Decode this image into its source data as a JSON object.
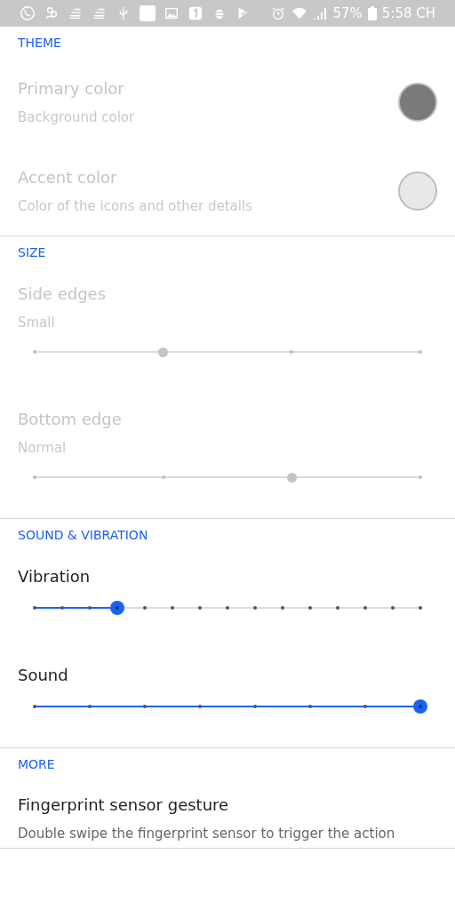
{
  "status_bar": {
    "battery": "57%",
    "time": "5:58 CH"
  },
  "sections": [
    {
      "title": "THEME",
      "items": [
        {
          "kind": "color",
          "title": "Primary color",
          "subtitle": "Background color",
          "disabled": true,
          "color": "#7a7a7a"
        },
        {
          "kind": "color",
          "title": "Accent color",
          "subtitle": "Color of the icons and other details",
          "disabled": true,
          "color": "#e8e8e8"
        }
      ]
    },
    {
      "title": "SIZE",
      "items": [
        {
          "kind": "slider",
          "title": "Side edges",
          "subtitle": "Small",
          "disabled": true,
          "level": 0.3333,
          "ticks": [
            {
              "selected": false
            },
            {
              "selected": true
            },
            {
              "selected": false
            },
            {
              "selected": false
            }
          ]
        },
        {
          "kind": "slider",
          "title": "Bottom edge",
          "subtitle": "Normal",
          "disabled": true,
          "level": 0.6667,
          "ticks": [
            {
              "selected": false
            },
            {
              "selected": false
            },
            {
              "selected": true
            },
            {
              "selected": false
            }
          ]
        }
      ]
    },
    {
      "title": "SOUND & VIBRATION",
      "items": [
        {
          "kind": "slider",
          "title": "Vibration",
          "disabled": false,
          "level": 0.2143,
          "ticks": [
            {
              "selected": false
            },
            {
              "selected": false
            },
            {
              "selected": false
            },
            {
              "selected": true
            },
            {
              "selected": false
            },
            {
              "selected": false
            },
            {
              "selected": false
            },
            {
              "selected": false
            },
            {
              "selected": false
            },
            {
              "selected": false
            },
            {
              "selected": false
            },
            {
              "selected": false
            },
            {
              "selected": false
            },
            {
              "selected": false
            },
            {
              "selected": false
            }
          ]
        },
        {
          "kind": "slider",
          "title": "Sound",
          "disabled": false,
          "level": 1,
          "ticks": [
            {
              "selected": false
            },
            {
              "selected": false
            },
            {
              "selected": false
            },
            {
              "selected": false
            },
            {
              "selected": false
            },
            {
              "selected": false
            },
            {
              "selected": false
            },
            {
              "selected": true
            }
          ]
        }
      ]
    },
    {
      "title": "MORE",
      "items": [
        {
          "kind": "text",
          "title": "Fingerprint sensor gesture",
          "subtitle": "Double swipe the fingerprint sensor to trigger the action",
          "disabled": false
        }
      ]
    }
  ]
}
